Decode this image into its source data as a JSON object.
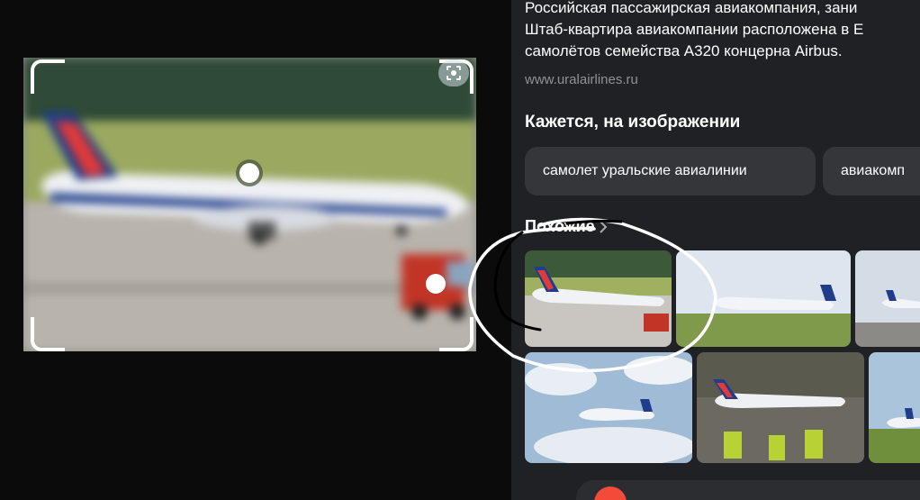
{
  "description": {
    "line1": "Российская пассажирская авиакомпания, зани",
    "line2": "Штаб-квартира авиакомпании расположена в Е",
    "line3": "самолётов семейства A320 концерна Airbus."
  },
  "source_site": "www.uralairlines.ru",
  "looks_like": {
    "title": "Кажется, на изображении",
    "chips": [
      "самолет уральские авиалинии",
      "авиакомп"
    ]
  },
  "similar": {
    "title": "Похожие",
    "arrow_icon": "chevron-right-icon"
  },
  "icons": {
    "lens": "lens-icon",
    "bottom": "camera-icon"
  },
  "colors": {
    "panel_bg": "#202124",
    "chip_bg": "#35363a",
    "page_bg": "#0b0b0c",
    "airline_red": "#e03a3a",
    "airline_blue": "#1f3d8a"
  }
}
